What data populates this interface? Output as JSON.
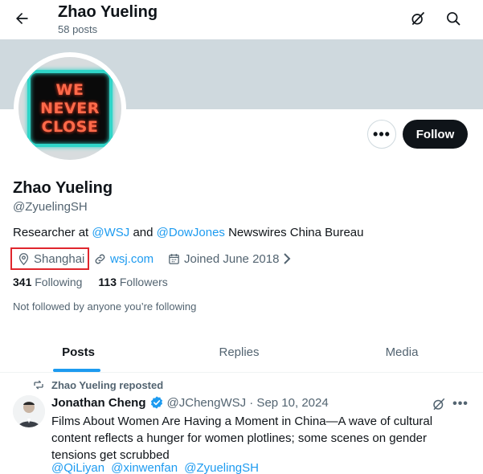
{
  "header": {
    "name": "Zhao Yueling",
    "posts_count": "58 posts",
    "back_icon": "back-arrow-icon",
    "grok_icon": "grok-icon",
    "search_icon": "search-icon"
  },
  "profile": {
    "avatar_text": [
      "WE",
      "NEVER",
      "CLOSE"
    ],
    "more_label": "•••",
    "follow_label": "Follow",
    "name": "Zhao Yueling",
    "handle": "@ZyuelingSH",
    "bio": {
      "prefix": "Researcher at ",
      "mention1": "@WSJ",
      "middle": " and ",
      "mention2": "@DowJones",
      "suffix": " Newswires China Bureau"
    },
    "location": "Shanghai",
    "website": "wsj.com",
    "joined": "Joined June 2018",
    "following_count": "341",
    "following_label": "Following",
    "followers_count": "113",
    "followers_label": "Followers",
    "not_followed": "Not followed by anyone you’re following"
  },
  "tabs": [
    {
      "label": "Posts",
      "active": true
    },
    {
      "label": "Replies",
      "active": false
    },
    {
      "label": "Media",
      "active": false
    }
  ],
  "post": {
    "reposted_by": "Zhao Yueling reposted",
    "author_name": "Jonathan Cheng",
    "author_handle": "@JChengWSJ · Sep 10, 2024",
    "more_label": "•••",
    "lines": [
      "Films About Women Are Having a Moment in China—A wave of cultural",
      "content reflects a hunger for women plotlines; some scenes on gender",
      "tensions get scrubbed"
    ],
    "mentions": [
      "@QiLiyan",
      "@xinwenfan",
      "@ZyuelingSH"
    ]
  },
  "colors": {
    "accent": "#1d9bf0",
    "banner": "#cfd9de",
    "highlight_box": "#e0262d"
  }
}
